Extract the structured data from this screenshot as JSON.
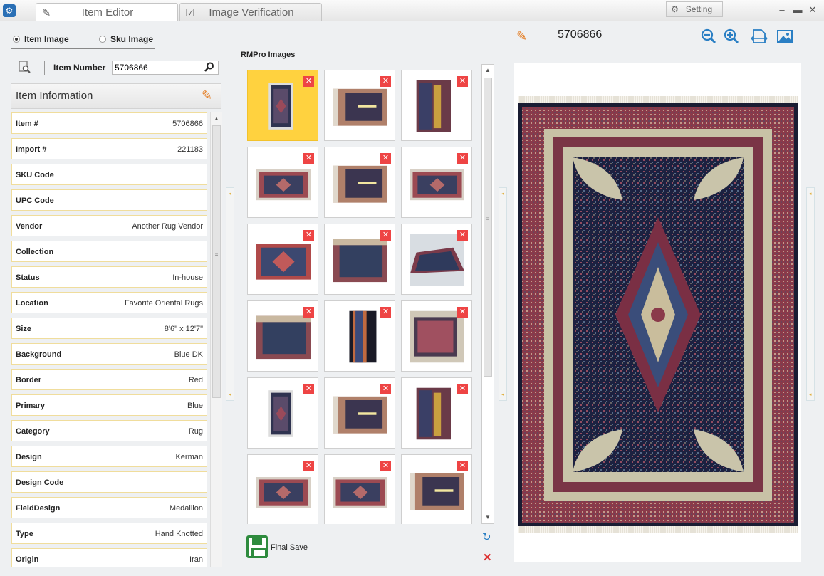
{
  "tabs": [
    {
      "label": "Item Editor"
    },
    {
      "label": "Image Verification"
    }
  ],
  "setting": {
    "label": "Setting"
  },
  "radios": [
    {
      "label": "Item Image",
      "selected": true
    },
    {
      "label": "Sku Image",
      "selected": false
    }
  ],
  "item_number": {
    "label": "Item Number",
    "value": "5706866"
  },
  "item_info": {
    "title": "Item Information"
  },
  "fields": [
    {
      "label": "Item #",
      "value": "5706866"
    },
    {
      "label": "Import #",
      "value": "221183"
    },
    {
      "label": "SKU Code",
      "value": ""
    },
    {
      "label": "UPC Code",
      "value": ""
    },
    {
      "label": "Vendor",
      "value": "Another Rug Vendor"
    },
    {
      "label": "Collection",
      "value": ""
    },
    {
      "label": "Status",
      "value": "In-house"
    },
    {
      "label": "Location",
      "value": "Favorite Oriental Rugs"
    },
    {
      "label": "Size",
      "value": "8'6\" x 12'7\""
    },
    {
      "label": "Background",
      "value": "Blue DK"
    },
    {
      "label": "Border",
      "value": "Red"
    },
    {
      "label": "Primary",
      "value": "Blue"
    },
    {
      "label": "Category",
      "value": "Rug"
    },
    {
      "label": "Design",
      "value": "Kerman"
    },
    {
      "label": "Design Code",
      "value": ""
    },
    {
      "label": "FieldDesign",
      "value": "Medallion"
    },
    {
      "label": "Type",
      "value": "Hand Knotted"
    },
    {
      "label": "Origin",
      "value": "Iran"
    }
  ],
  "rmpro": {
    "title": "RMPro Images",
    "delete_glyph": "✕"
  },
  "images": [
    {
      "kind": "rug-small",
      "selected": true
    },
    {
      "kind": "rug-close",
      "selected": false
    },
    {
      "kind": "rug-roll",
      "selected": false
    },
    {
      "kind": "rug-wide",
      "selected": false
    },
    {
      "kind": "rug-close",
      "selected": false
    },
    {
      "kind": "rug-wide",
      "selected": false
    },
    {
      "kind": "rug-wide-red",
      "selected": false
    },
    {
      "kind": "rug-corner",
      "selected": false
    },
    {
      "kind": "rug-persp",
      "selected": false
    },
    {
      "kind": "rug-corner",
      "selected": false
    },
    {
      "kind": "rug-edge",
      "selected": false
    },
    {
      "kind": "rug-back",
      "selected": false
    },
    {
      "kind": "rug-small",
      "selected": false
    },
    {
      "kind": "rug-close",
      "selected": false
    },
    {
      "kind": "rug-roll",
      "selected": false
    },
    {
      "kind": "rug-wide",
      "selected": false
    },
    {
      "kind": "rug-wide",
      "selected": false
    },
    {
      "kind": "rug-close",
      "selected": false
    }
  ],
  "final_save": {
    "label": "Final Save"
  },
  "preview": {
    "item_number": "5706866"
  },
  "icons": {
    "app": "app-icon",
    "zoom_out": "zoom-out-icon",
    "zoom_in": "zoom-in-icon",
    "fit_width": "fit-width-icon",
    "image": "image-icon"
  },
  "colors": {
    "accent": "#2a7fc4",
    "edit": "#e37a1e",
    "selected": "#ffd23f",
    "delete": "#e44444",
    "field_border": "#f0dd9c"
  }
}
